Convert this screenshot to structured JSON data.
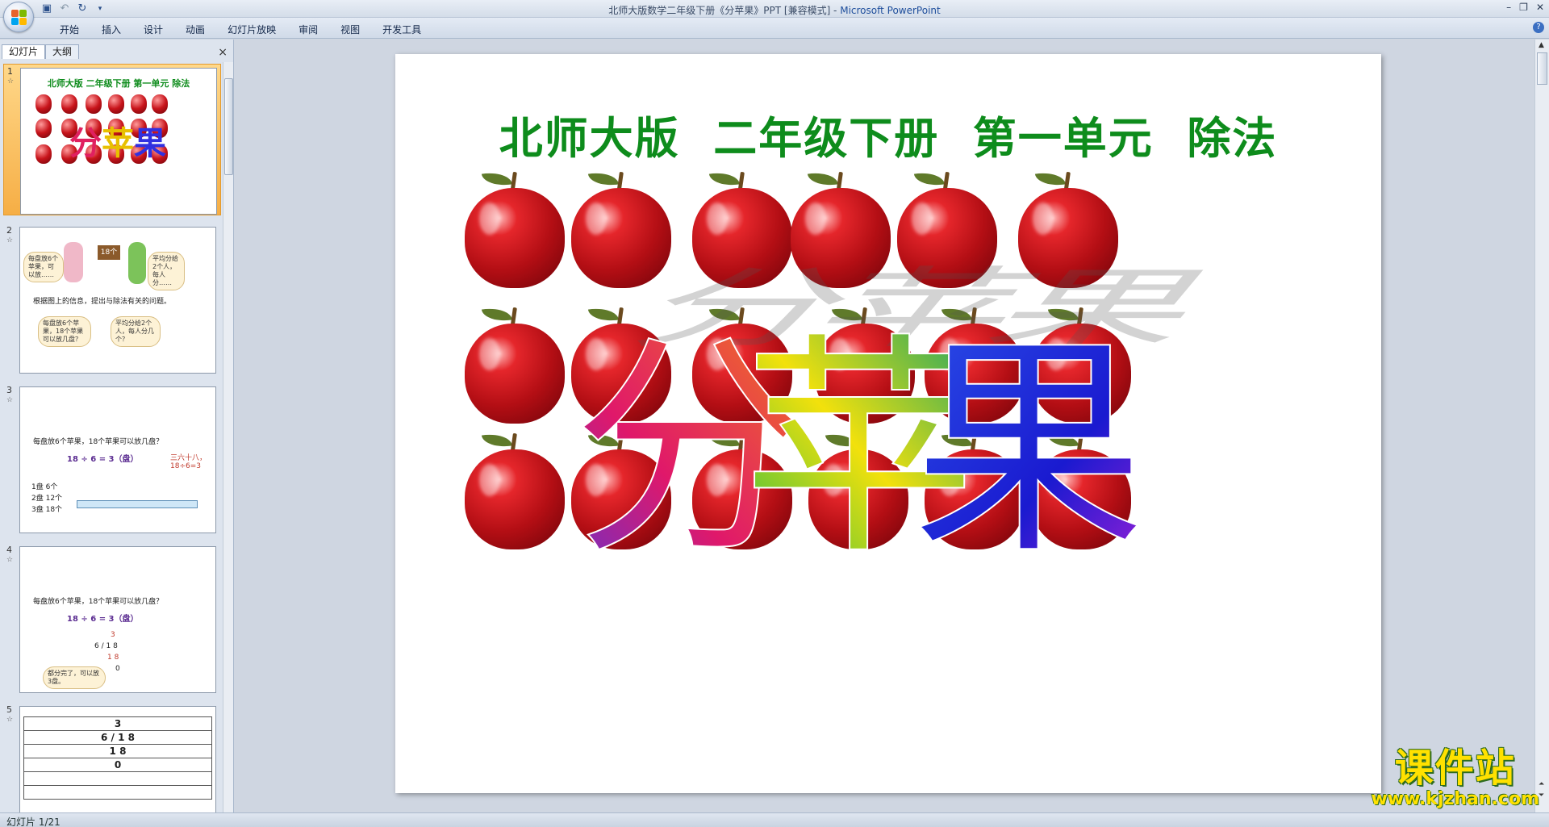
{
  "window": {
    "title": "北师大版数学二年级下册《分苹果》PPT [兼容模式] - ",
    "app_name": "Microsoft PowerPoint"
  },
  "ribbon": {
    "tabs": [
      "开始",
      "插入",
      "设计",
      "动画",
      "幻灯片放映",
      "审阅",
      "视图",
      "开发工具"
    ]
  },
  "panel": {
    "tab_slides": "幻灯片",
    "tab_outline": "大纲",
    "close": "×"
  },
  "thumbnails": [
    {
      "num": "1",
      "title": "北师大版  二年级下册  第一单元  除法",
      "word": "分苹果"
    },
    {
      "num": "2",
      "sign": "18个",
      "bubble_left": "每盘放6个苹果，可以放……",
      "bubble_right": "平均分给2个人，每人分……",
      "question": "根据图上的信息，提出与除法有关的问题。",
      "bubble_b1": "每盘放6个苹果，18个苹果可以放几盘？",
      "bubble_b2": "平均分给2个人，每人分几个？"
    },
    {
      "num": "3",
      "question": "每盘放6个苹果，18个苹果可以放几盘？",
      "equation": "18 ÷ 6 = 3（盘）",
      "rows": [
        "1盘  6个",
        "2盘  12个",
        "3盘  18个"
      ],
      "hint": "三六十八，18÷6=3"
    },
    {
      "num": "4",
      "question": "每盘放6个苹果，18个苹果可以放几盘？",
      "equation": "18 ÷ 6 = 3（盘）",
      "long_div": [
        "3",
        "6 / 1 8",
        "1 8",
        "0"
      ],
      "bubble": "都分完了，可以放3盘。"
    },
    {
      "num": "5",
      "table": [
        "3",
        "6 / 1 8",
        "1 8",
        "0"
      ]
    }
  ],
  "slide": {
    "title": "北师大版  二年级下册  第一单元  除法",
    "art_word": [
      "分",
      "苹",
      "果"
    ],
    "apple_count": 18
  },
  "watermark": {
    "big": "课件站",
    "url": "www.kjzhan.com"
  },
  "status": {
    "slide_indicator": "幻灯片 1/21"
  },
  "colors": {
    "title_green": "#0e8c1c",
    "selection_orange": "#f6ae45",
    "apple_red": "#c8141b",
    "watermark_yellow": "#ffe100"
  }
}
